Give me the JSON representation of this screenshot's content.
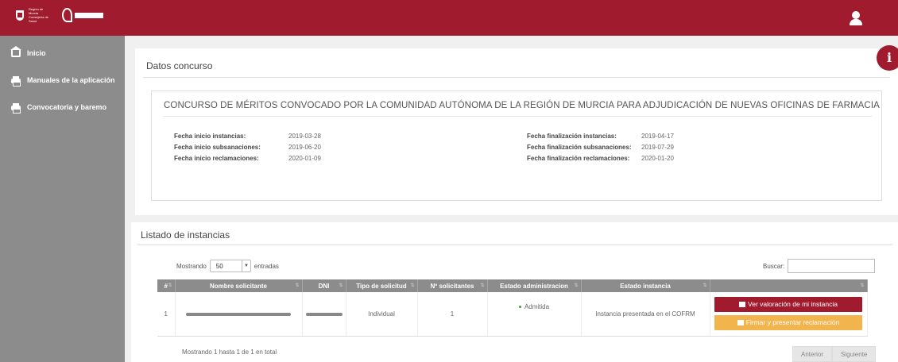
{
  "header": {
    "logo_text": "Región de Murcia Consejería de Salud",
    "user_icon": "user-icon"
  },
  "sidebar": {
    "items": [
      {
        "label": "Inicio",
        "icon": "home-icon"
      },
      {
        "label": "Manuales de la aplicación",
        "icon": "print-icon"
      },
      {
        "label": "Convocatoria y baremo",
        "icon": "print-icon"
      }
    ]
  },
  "datos": {
    "title": "Datos concurso",
    "concurso_title": "CONCURSO DE MÉRITOS CONVOCADO POR LA COMUNIDAD AUTÓNOMA DE LA REGIÓN DE MURCIA PARA ADJUDICACIÓN DE NUEVAS OFICINAS DE FARMACIA",
    "left": [
      {
        "label": "Fecha inicio instancias:",
        "value": "2019-03-28"
      },
      {
        "label": "Fecha inicio subsanaciones:",
        "value": "2019-06-20"
      },
      {
        "label": "Fecha inicio reclamaciones:",
        "value": "2020-01-09"
      }
    ],
    "right": [
      {
        "label": "Fecha finalización instancias:",
        "value": "2019-04-17"
      },
      {
        "label": "Fecha finalización subsanaciones:",
        "value": "2019-07-29"
      },
      {
        "label": "Fecha finalización reclamaciones:",
        "value": "2020-01-20"
      }
    ]
  },
  "info_button": {
    "label": "i"
  },
  "listado": {
    "title": "Listado de instancias",
    "mostrando_prefix": "Mostrando",
    "page_size": "50",
    "mostrando_suffix": "entradas",
    "buscar_label": "Buscar:",
    "columns": [
      "#",
      "Nombre solicitante",
      "DNI",
      "Tipo de solicitud",
      "Nº solicitantes",
      "Estado administracion",
      "Estado instancia",
      ""
    ],
    "rows": [
      {
        "num": "1",
        "tipo": "Individual",
        "solicitantes": "1",
        "estado_admin": "Admitida",
        "estado_instancia": "Instancia presentada en el COFRM",
        "btn_ver": "Ver valoración de mi instancia",
        "btn_firmar": "Firmar y presentar reclamación"
      }
    ],
    "footer_info": "Mostrando 1 hasta 1 de 1 en total",
    "prev": "Anterior",
    "next": "Siguiente"
  },
  "colors": {
    "brand": "#a01b2d",
    "sidebar": "#8c8c8c",
    "accent": "#f2b44d",
    "success": "#3aa23a"
  }
}
